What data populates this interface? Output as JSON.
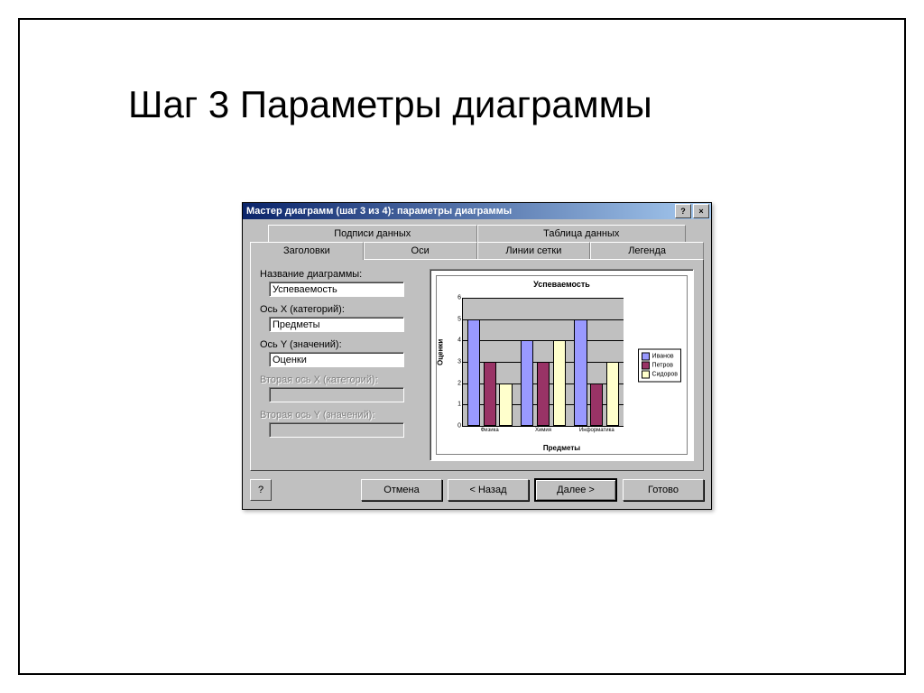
{
  "slide": {
    "title": "Шаг 3 Параметры диаграммы"
  },
  "dialog": {
    "title": "Мастер диаграмм (шаг 3 из 4): параметры диаграммы",
    "help_glyph": "?",
    "close_glyph": "×",
    "tabs_back": [
      "Подписи данных",
      "Таблица данных"
    ],
    "tabs_front": [
      "Заголовки",
      "Оси",
      "Линии сетки",
      "Легенда"
    ],
    "active_tab": "Заголовки",
    "fields": {
      "chart_title_label": "Название диаграммы:",
      "chart_title_value": "Успеваемость",
      "x_axis_label": "Ось X (категорий):",
      "x_axis_value": "Предметы",
      "y_axis_label": "Ось Y (значений):",
      "y_axis_value": "Оценки",
      "x2_axis_label": "Вторая ось X (категорий):",
      "x2_axis_value": "",
      "y2_axis_label": "Вторая ось Y (значений):",
      "y2_axis_value": ""
    },
    "buttons": {
      "help_glyph": "?",
      "cancel": "Отмена",
      "back": "< Назад",
      "next": "Далее >",
      "finish": "Готово"
    }
  },
  "chart_data": {
    "type": "bar",
    "title": "Успеваемость",
    "xlabel": "Предметы",
    "ylabel": "Оценки",
    "ylim": [
      0,
      6
    ],
    "yticks": [
      0,
      1,
      2,
      3,
      4,
      5,
      6
    ],
    "categories": [
      "Физика",
      "Химия",
      "Информатика"
    ],
    "series": [
      {
        "name": "Иванов",
        "color": "#9999ff",
        "values": [
          5,
          4,
          5
        ]
      },
      {
        "name": "Петров",
        "color": "#993366",
        "values": [
          3,
          3,
          2
        ]
      },
      {
        "name": "Сидоров",
        "color": "#ffffcc",
        "values": [
          2,
          4,
          3
        ]
      }
    ]
  }
}
